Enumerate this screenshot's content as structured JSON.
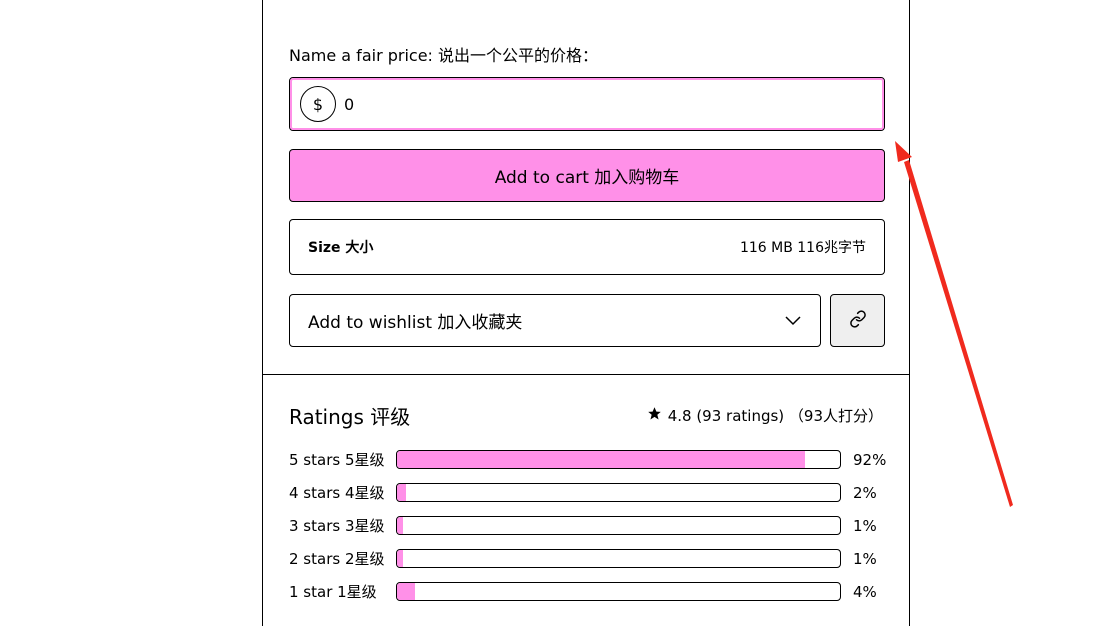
{
  "price": {
    "label": "Name a fair price:  说出一个公平的价格：",
    "currency_symbol": "$",
    "value": "0"
  },
  "cart_button": {
    "label": "Add to cart  加入购物车"
  },
  "size": {
    "label": "Size 大小",
    "value": "116 MB 116兆字节"
  },
  "wishlist": {
    "label": "Add to wishlist 加入收藏夹"
  },
  "ratings": {
    "title": "Ratings 评级",
    "summary": "4.8 (93 ratings) （93人打分）",
    "rows": [
      {
        "label": "5 stars 5星级",
        "percent_text": "92%",
        "percent": 92
      },
      {
        "label": "4 stars 4星级",
        "percent_text": "2%",
        "percent": 2
      },
      {
        "label": "3 stars 3星级",
        "percent_text": "1%",
        "percent": 1
      },
      {
        "label": "2 stars 2星级",
        "percent_text": "1%",
        "percent": 1
      },
      {
        "label": "1 star 1星级",
        "percent_text": "4%",
        "percent": 4
      }
    ]
  },
  "colors": {
    "accent": "#ff90e8",
    "annotation_arrow": "#f02a1e"
  },
  "icons": {
    "chevron": "chevron-down-icon",
    "link": "link-icon",
    "star": "star-icon"
  }
}
